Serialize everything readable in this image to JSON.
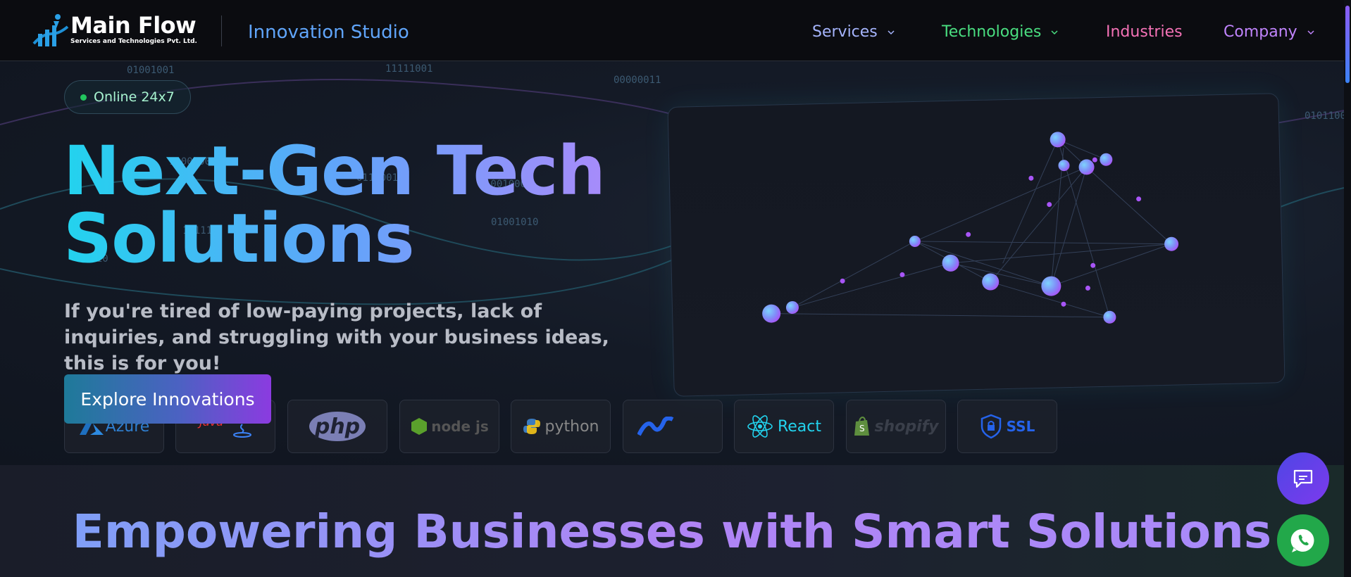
{
  "brand": {
    "title": "Main Flow",
    "subtitle": "Services and Technologies Pvt. Ltd.",
    "studio": "Innovation Studio"
  },
  "nav": {
    "items": [
      {
        "label": "Services",
        "color": "#a5b4fc",
        "has_dropdown": true
      },
      {
        "label": "Technologies",
        "color": "#4ade80",
        "has_dropdown": true
      },
      {
        "label": "Industries",
        "color": "#f472b6",
        "has_dropdown": false
      },
      {
        "label": "Company",
        "color": "#c084fc",
        "has_dropdown": true
      }
    ]
  },
  "hero": {
    "badge": "Online 24x7",
    "headline_line1": "Next-Gen Tech",
    "headline_line2": "Solutions",
    "subtext": "If you're tired of low-paying projects, lack of inquiries, and struggling with your business ideas, this is for you!",
    "cta": "Explore Innovations",
    "binary_strings": [
      "01001001",
      "11111001",
      "00000011",
      "0101100",
      "1100000",
      "01110010",
      "10010001",
      "01001010",
      "11111",
      "1010"
    ]
  },
  "tech_logos": [
    {
      "name": "Azure",
      "icon": "azure-logo"
    },
    {
      "name": "Java",
      "icon": "java-logo"
    },
    {
      "name": "php",
      "icon": "php-logo"
    },
    {
      "name": "node js",
      "icon": "nodejs-logo"
    },
    {
      "name": "python",
      "icon": "python-logo"
    },
    {
      "name": "",
      "icon": "dotnet-logo"
    },
    {
      "name": "React",
      "icon": "react-logo"
    },
    {
      "name": "shopify",
      "icon": "shopify-logo"
    },
    {
      "name": "SSL",
      "icon": "ssl-secured-logo"
    }
  ],
  "section2": {
    "heading": "Empowering Businesses with Smart Solutions"
  },
  "floating": {
    "chat_icon": "chat-icon",
    "whatsapp_icon": "whatsapp-icon"
  },
  "colors": {
    "accent_cyan": "#22d3ee",
    "accent_purple": "#a78bfa",
    "whatsapp": "#22a84a",
    "chat": "#6d3fe0"
  }
}
